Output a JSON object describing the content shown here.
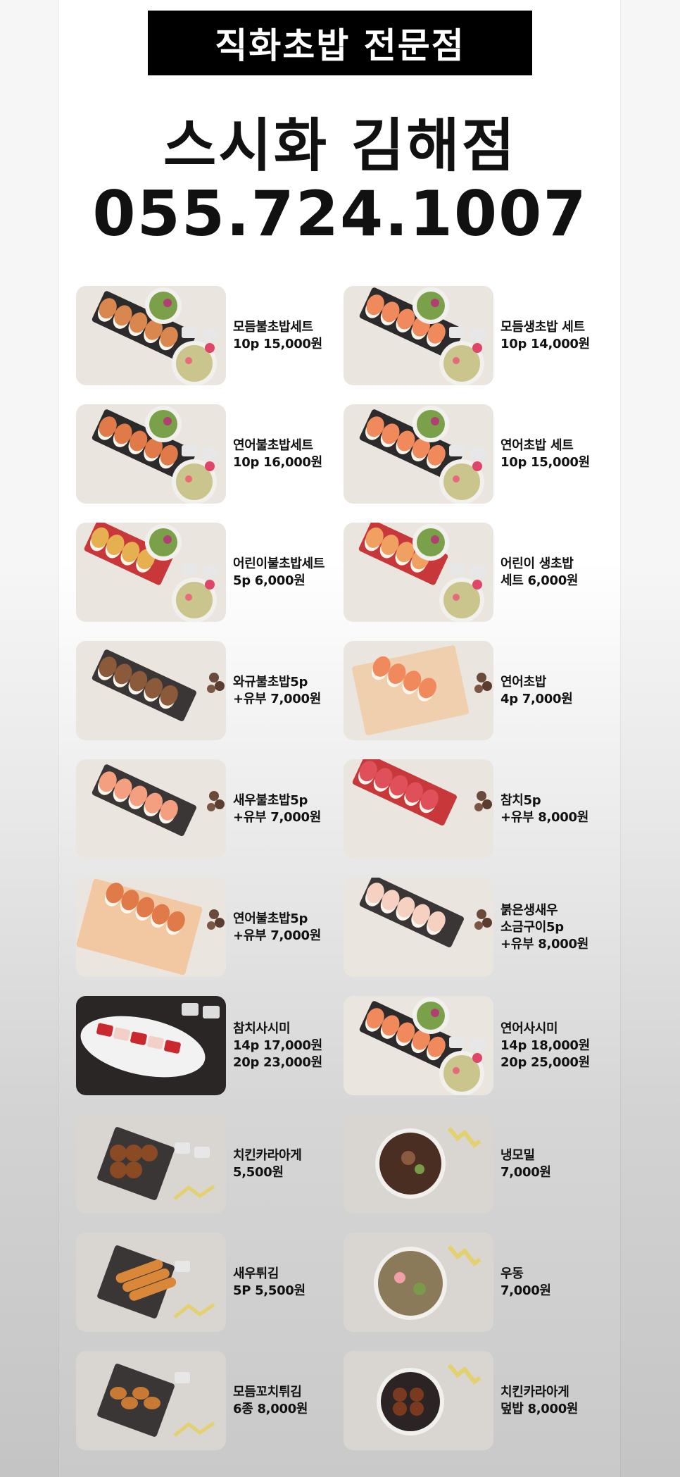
{
  "header": {
    "banner": "직화초밥 전문점",
    "store_name": "스시화 김해점",
    "phone": "055.724.1007"
  },
  "menu": [
    {
      "lines": [
        "모듬불초밥세트",
        "10p 15,000원"
      ],
      "photo": "set-torched-platter"
    },
    {
      "lines": [
        "모듬생초밥 세트",
        "10p 14,000원"
      ],
      "photo": "set-raw-platter"
    },
    {
      "lines": [
        "연어불초밥세트",
        "10p 16,000원"
      ],
      "photo": "set-torched-salmon"
    },
    {
      "lines": [
        "연어초밥 세트",
        "10p 15,000원"
      ],
      "photo": "set-salmon"
    },
    {
      "lines": [
        "어린이불초밥세트",
        "5p 6,000원"
      ],
      "photo": "kids-torched-set"
    },
    {
      "lines": [
        "어린이 생초밥",
        "세트 6,000원"
      ],
      "photo": "kids-raw-set"
    },
    {
      "lines": [
        "와규불초밥5p",
        "+유부 7,000원"
      ],
      "photo": "wagyu-sushi"
    },
    {
      "lines": [
        "연어초밥",
        "4p 7,000원"
      ],
      "photo": "salmon-sushi"
    },
    {
      "lines": [
        "새우불초밥5p",
        "+유부 7,000원"
      ],
      "photo": "shrimp-sushi"
    },
    {
      "lines": [
        "참치5p",
        "+유부 8,000원"
      ],
      "photo": "tuna-sushi"
    },
    {
      "lines": [
        "연어불초밥5p",
        "+유부 7,000원"
      ],
      "photo": "torched-salmon-sushi"
    },
    {
      "lines": [
        "붉은생새우",
        "소금구이5p",
        "+유부 8,000원"
      ],
      "photo": "red-shrimp-sushi"
    },
    {
      "lines": [
        "참치사시미",
        "14p 17,000원",
        "20p 23,000원"
      ],
      "photo": "tuna-sashimi"
    },
    {
      "lines": [
        "연어사시미",
        "14p 18,000원",
        "20p 25,000원"
      ],
      "photo": "salmon-sashimi"
    },
    {
      "lines": [
        "치킨카라아게",
        "5,500원"
      ],
      "photo": "chicken-karaage"
    },
    {
      "lines": [
        "냉모밀",
        "7,000원"
      ],
      "photo": "cold-soba"
    },
    {
      "lines": [
        "새우튀김",
        "5P 5,500원"
      ],
      "photo": "shrimp-tempura"
    },
    {
      "lines": [
        "우동",
        "7,000원"
      ],
      "photo": "udon"
    },
    {
      "lines": [
        "모듬꼬치튀김",
        "6종 8,000원"
      ],
      "photo": "skewer-tempura"
    },
    {
      "lines": [
        "치킨카라아게",
        "덮밥 8,000원"
      ],
      "photo": "karaage-rice-bowl"
    }
  ],
  "colors": {
    "banner_bg": "#000000",
    "banner_text": "#ffffff",
    "text": "#111111",
    "salmon": "#f08a5d",
    "tuna": "#e0505a",
    "rice": "#fbf7ef"
  }
}
